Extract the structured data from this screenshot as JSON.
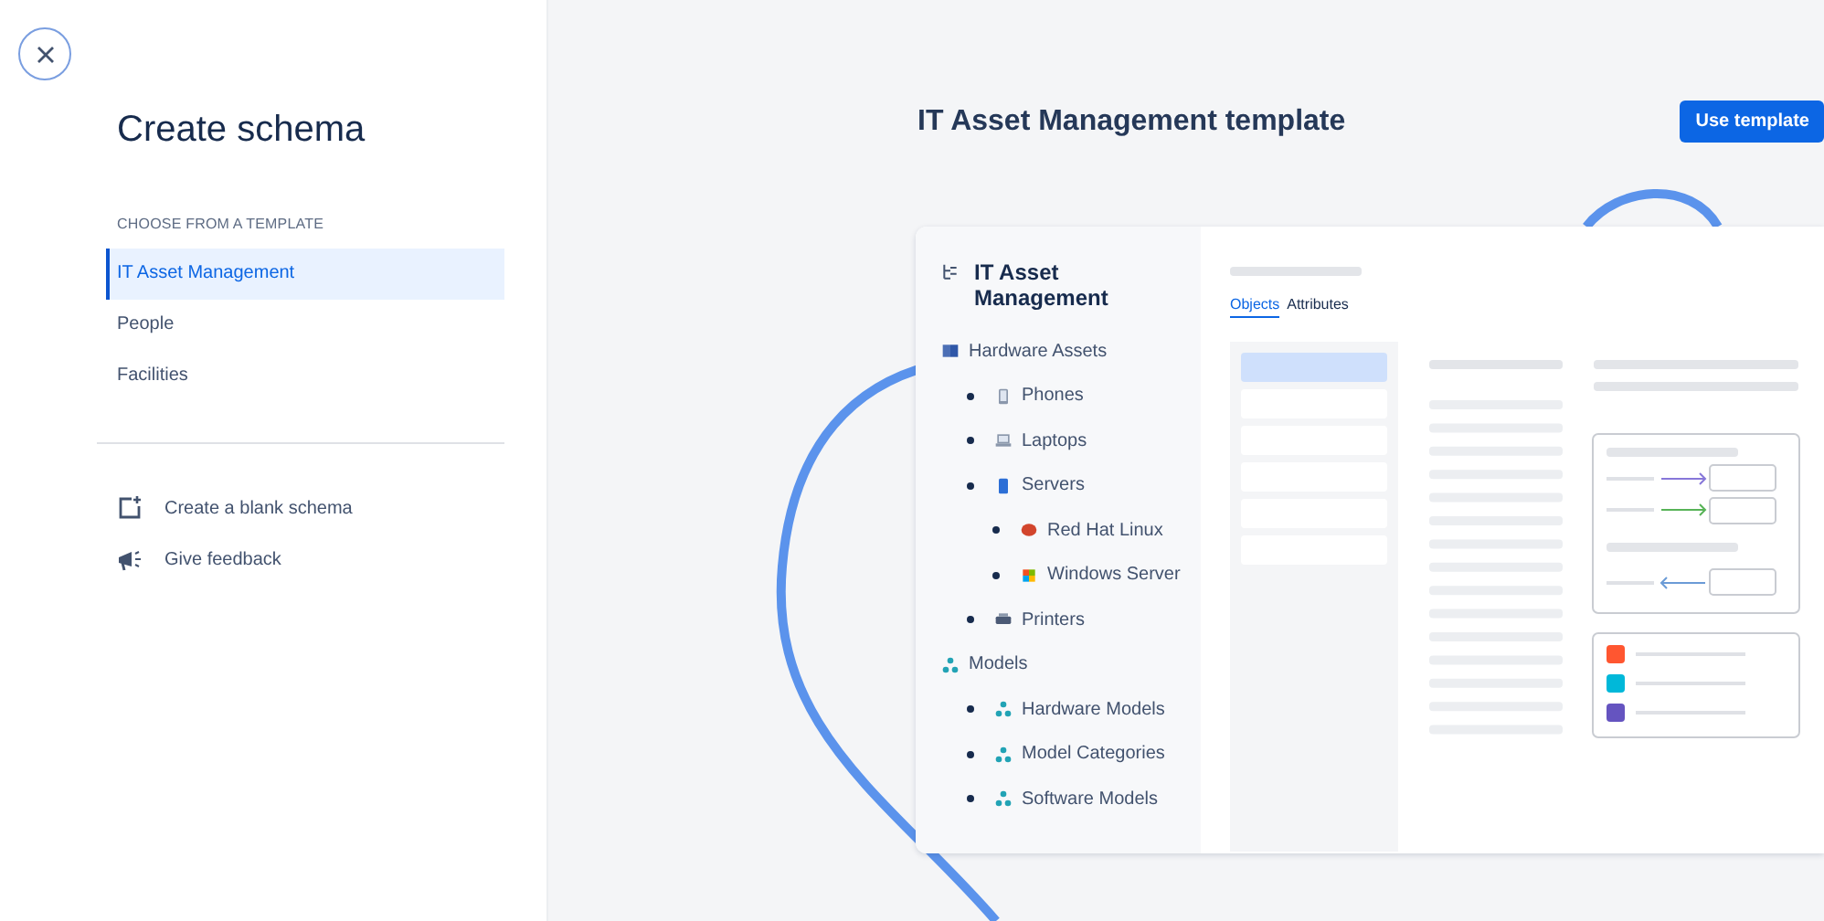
{
  "sidebar": {
    "title": "Create schema",
    "section_label": "CHOOSE FROM A TEMPLATE",
    "templates": [
      {
        "label": "IT Asset Management",
        "selected": true
      },
      {
        "label": "People",
        "selected": false
      },
      {
        "label": "Facilities",
        "selected": false
      }
    ],
    "actions": [
      {
        "label": "Create a blank schema",
        "kind": "add"
      },
      {
        "label": "Give feedback",
        "kind": "feedback"
      }
    ]
  },
  "preview": {
    "title": "IT Asset Management template",
    "button": "Use template",
    "schema_title": "IT Asset Management",
    "tree": [
      {
        "label": "Hardware Assets",
        "kind": "book",
        "children": [
          {
            "label": "Phones",
            "kind": "phone"
          },
          {
            "label": "Laptops",
            "kind": "laptop"
          },
          {
            "label": "Servers",
            "kind": "server",
            "children": [
              {
                "label": "Red Hat Linux",
                "kind": "hat"
              },
              {
                "label": "Windows Server",
                "kind": "tiles"
              }
            ]
          },
          {
            "label": "Printers",
            "kind": "printer"
          }
        ]
      },
      {
        "label": "Models",
        "kind": "nodes",
        "children": [
          {
            "label": "Hardware Models",
            "kind": "nodes"
          },
          {
            "label": "Model Categories",
            "kind": "nodes"
          },
          {
            "label": "Software Models",
            "kind": "nodes"
          }
        ]
      }
    ],
    "tabs": [
      {
        "label": "Objects",
        "selected": true
      },
      {
        "label": "Attributes",
        "selected": false
      }
    ]
  }
}
